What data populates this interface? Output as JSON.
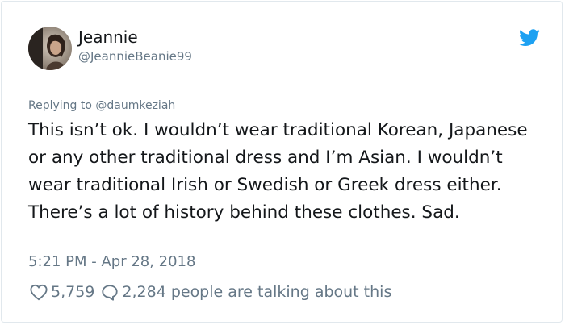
{
  "author": {
    "name": "Jeannie",
    "handle": "@JeannieBeanie99"
  },
  "replying_to": "Replying to @daumkeziah",
  "tweet": {
    "text": "This isn’t ok. I wouldn’t wear traditional Korean, Japanese or any other traditional dress and I’m Asian. I wouldn’t wear traditional Irish or Swedish or Greek dress either. There’s a lot of history behind these clothes. Sad.",
    "timestamp": "5:21 PM - Apr 28, 2018"
  },
  "stats": {
    "likes": "5,759",
    "replies": "2,284",
    "talking_label": "people are talking about this"
  },
  "icons": {
    "brand": "twitter-bird-icon",
    "like": "heart-icon",
    "reply": "comment-bubble-icon"
  },
  "colors": {
    "twitter_blue": "#1da1f2",
    "secondary_text": "#657786",
    "primary_text": "#14171a",
    "border": "#e1e8ed"
  }
}
